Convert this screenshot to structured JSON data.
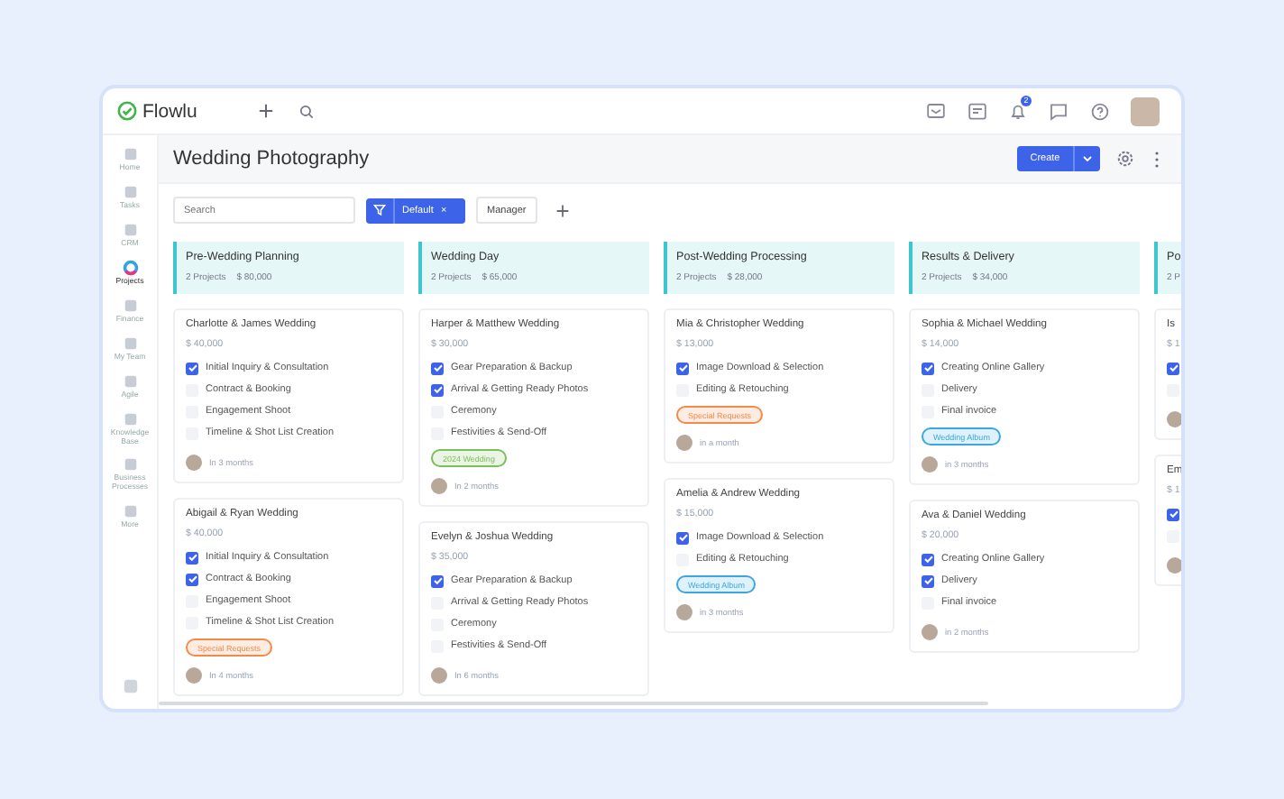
{
  "app": {
    "logo": "Flowlu",
    "notifications": "2"
  },
  "sidebar": {
    "items": [
      {
        "label": "Home",
        "selected": false
      },
      {
        "label": "Tasks",
        "selected": false
      },
      {
        "label": "CRM",
        "selected": false
      },
      {
        "label": "Projects",
        "selected": true
      },
      {
        "label": "Finance",
        "selected": false
      },
      {
        "label": "My Team",
        "selected": false
      },
      {
        "label": "Agile",
        "selected": false
      },
      {
        "label": "Knowledge Base",
        "selected": false
      },
      {
        "label": "Business Processes",
        "selected": false
      },
      {
        "label": "More",
        "selected": false
      }
    ]
  },
  "header": {
    "title": "Wedding Photography",
    "create": "Create"
  },
  "toolbar": {
    "search": {
      "placeholder": "Search"
    },
    "filter": {
      "label": "Default",
      "clear": "×"
    },
    "manager": "Manager"
  },
  "columns": [
    {
      "kind": "full",
      "title": "Pre-Wedding Planning",
      "count": "2 Projects",
      "total": "$ 80,000",
      "cards": [
        {
          "title": "Charlotte & James Wedding",
          "price": "$ 40,000",
          "tasks": [
            {
              "label": "Initial Inquiry & Consultation",
              "checked": true
            },
            {
              "label": "Contract & Booking",
              "checked": false
            },
            {
              "label": "Engagement Shoot",
              "checked": false
            },
            {
              "label": "Timeline & Shot List Creation",
              "checked": false
            }
          ],
          "due": "In 3 months"
        },
        {
          "title": "Abigail & Ryan Wedding",
          "price": "$ 40,000",
          "tasks": [
            {
              "label": "Initial Inquiry & Consultation",
              "checked": true
            },
            {
              "label": "Contract & Booking",
              "checked": true
            },
            {
              "label": "Engagement Shoot",
              "checked": false
            },
            {
              "label": "Timeline & Shot List Creation",
              "checked": false
            }
          ],
          "tag": {
            "label": "Special Requests",
            "color": "#f5894a"
          },
          "due": "In 4 months"
        }
      ]
    },
    {
      "kind": "full",
      "title": "Wedding Day",
      "count": "2 Projects",
      "total": "$ 65,000",
      "cards": [
        {
          "title": "Harper & Matthew Wedding",
          "price": "$ 30,000",
          "tasks": [
            {
              "label": "Gear Preparation & Backup",
              "checked": true
            },
            {
              "label": "Arrival & Getting Ready Photos",
              "checked": true
            },
            {
              "label": "Ceremony",
              "checked": false
            },
            {
              "label": "Festivities & Send-Off",
              "checked": false
            }
          ],
          "tag": {
            "label": "2024 Wedding",
            "color": "#7cbf5a"
          },
          "due": "In 2 months"
        },
        {
          "title": "Evelyn & Joshua Wedding",
          "price": "$ 35,000",
          "tasks": [
            {
              "label": "Gear Preparation & Backup",
              "checked": true
            },
            {
              "label": "Arrival & Getting Ready Photos",
              "checked": false
            },
            {
              "label": "Ceremony",
              "checked": false
            },
            {
              "label": "Festivities & Send-Off",
              "checked": false
            }
          ],
          "due": "In 6 months"
        }
      ]
    },
    {
      "kind": "full",
      "title": "Post-Wedding Processing",
      "count": "2 Projects",
      "total": "$ 28,000",
      "cards": [
        {
          "title": "Mia & Christopher Wedding",
          "price": "$ 13,000",
          "tasks": [
            {
              "label": "Image Download & Selection",
              "checked": true
            },
            {
              "label": "Editing & Retouching",
              "checked": false
            }
          ],
          "tag": {
            "label": "Special Requests",
            "color": "#f5894a"
          },
          "due": "in a month"
        },
        {
          "title": "Amelia & Andrew Wedding",
          "price": "$ 15,000",
          "tasks": [
            {
              "label": "Image Download & Selection",
              "checked": true
            },
            {
              "label": "Editing & Retouching",
              "checked": false
            }
          ],
          "tag": {
            "label": "Wedding Album",
            "color": "#3aa8e0"
          },
          "due": "in 3 months"
        }
      ]
    },
    {
      "kind": "full",
      "title": "Results & Delivery",
      "count": "2 Projects",
      "total": "$ 34,000",
      "cards": [
        {
          "title": "Sophia & Michael Wedding",
          "price": "$ 14,000",
          "tasks": [
            {
              "label": "Creating Online Gallery",
              "checked": true
            },
            {
              "label": "Delivery",
              "checked": false
            },
            {
              "label": "Final invoice",
              "checked": false
            }
          ],
          "tag": {
            "label": "Wedding Album",
            "color": "#3aa8e0"
          },
          "due": "in 3 months"
        },
        {
          "title": "Ava & Daniel Wedding",
          "price": "$ 20,000",
          "tasks": [
            {
              "label": "Creating Online Gallery",
              "checked": true
            },
            {
              "label": "Delivery",
              "checked": true
            },
            {
              "label": "Final invoice",
              "checked": false
            }
          ],
          "due": "in 2 months"
        }
      ]
    },
    {
      "kind": "cut",
      "title": "Po",
      "count": "2 P",
      "cards": [
        {
          "title": "Is",
          "price": "$ 1",
          "tasks": [
            {
              "checked": true
            },
            {
              "checked": false
            }
          ]
        },
        {
          "title": "Em",
          "price": "$ 1",
          "tasks": [
            {
              "checked": true
            },
            {
              "checked": false
            }
          ]
        }
      ]
    }
  ]
}
